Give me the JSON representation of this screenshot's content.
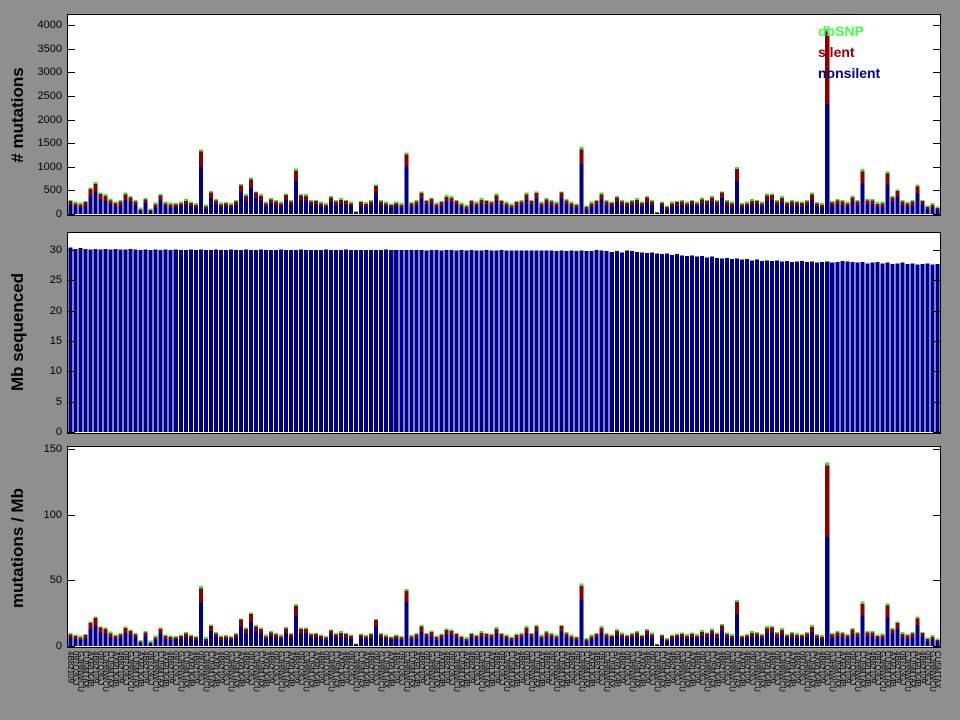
{
  "chart_data": {
    "type": "bar",
    "description": "Per-sample mutation summary: stacked counts, sequenced megabases, and mutation rate",
    "panels": [
      {
        "id": "mutations",
        "ylabel": "# mutations",
        "ylim": [
          0,
          4230
        ],
        "yticks": [
          0,
          500,
          1000,
          1500,
          2000,
          2500,
          3000,
          3500,
          4000
        ],
        "stacked": true,
        "stack_order": [
          "nonsilent",
          "silent",
          "dbSNP"
        ]
      },
      {
        "id": "mb",
        "ylabel": "Mb sequenced",
        "ylim": [
          0,
          33
        ],
        "yticks": [
          0,
          5,
          10,
          15,
          20,
          25,
          30
        ],
        "stacked": false,
        "series": "mb"
      },
      {
        "id": "rate",
        "ylabel": "mutations / Mb",
        "ylim": [
          0,
          152
        ],
        "yticks": [
          0,
          50,
          100,
          150
        ],
        "stacked": true,
        "derived": "(nonsilent+silent+dbSNP)/mb"
      }
    ],
    "legend": [
      {
        "label": "dbSNP",
        "color": "#44FF44"
      },
      {
        "label": "silent",
        "color": "#990000"
      },
      {
        "label": "nonsilent",
        "color": "#00008B"
      }
    ],
    "colors": {
      "nonsilent": "#00008B",
      "silent": "#8B0000",
      "dbSNP": "#33E833",
      "mb": "#00008B",
      "background": "#8F8F8F"
    },
    "grid": false,
    "samples": {
      "count": 174,
      "nonsilent": [
        200,
        165,
        140,
        185,
        390,
        475,
        310,
        285,
        210,
        170,
        195,
        300,
        260,
        195,
        65,
        230,
        55,
        140,
        290,
        165,
        140,
        145,
        165,
        205,
        170,
        140,
        1000,
        110,
        340,
        210,
        140,
        160,
        140,
        190,
        450,
        285,
        545,
        335,
        285,
        160,
        230,
        195,
        160,
        295,
        195,
        700,
        290,
        285,
        190,
        200,
        165,
        135,
        260,
        195,
        220,
        200,
        165,
        25,
        185,
        155,
        190,
        440,
        195,
        160,
        135,
        165,
        135,
        1010,
        160,
        195,
        325,
        200,
        230,
        140,
        185,
        270,
        250,
        200,
        145,
        110,
        200,
        165,
        220,
        200,
        180,
        285,
        200,
        165,
        125,
        185,
        195,
        300,
        200,
        330,
        160,
        230,
        195,
        160,
        335,
        210,
        160,
        135,
        1060,
        100,
        160,
        200,
        305,
        190,
        170,
        255,
        190,
        170,
        195,
        220,
        170,
        255,
        190,
        20,
        170,
        100,
        160,
        185,
        195,
        160,
        200,
        165,
        225,
        200,
        255,
        190,
        335,
        195,
        160,
        700,
        145,
        165,
        205,
        200,
        165,
        285,
        295,
        195,
        250,
        170,
        195,
        175,
        170,
        195,
        300,
        160,
        140,
        2330,
        175,
        215,
        195,
        160,
        260,
        195,
        650,
        210,
        215,
        155,
        160,
        620,
        260,
        360,
        190,
        160,
        195,
        430,
        200,
        100,
        135,
        90
      ],
      "silent": [
        70,
        60,
        60,
        65,
        135,
        165,
        110,
        100,
        80,
        60,
        70,
        110,
        90,
        70,
        35,
        80,
        30,
        60,
        100,
        60,
        60,
        55,
        60,
        75,
        60,
        55,
        320,
        50,
        120,
        75,
        60,
        60,
        55,
        70,
        150,
        100,
        185,
        115,
        100,
        60,
        80,
        70,
        60,
        105,
        70,
        215,
        100,
        100,
        70,
        70,
        60,
        55,
        90,
        70,
        80,
        70,
        60,
        15,
        65,
        60,
        70,
        150,
        70,
        60,
        55,
        60,
        55,
        245,
        60,
        70,
        115,
        70,
        85,
        60,
        65,
        95,
        90,
        70,
        60,
        50,
        70,
        60,
        80,
        70,
        65,
        105,
        70,
        60,
        55,
        65,
        70,
        110,
        70,
        115,
        60,
        80,
        70,
        60,
        115,
        75,
        60,
        55,
        300,
        45,
        60,
        70,
        110,
        70,
        60,
        90,
        70,
        60,
        70,
        80,
        60,
        90,
        70,
        10,
        60,
        45,
        60,
        65,
        70,
        60,
        70,
        60,
        85,
        70,
        90,
        70,
        115,
        70,
        60,
        255,
        55,
        60,
        75,
        70,
        60,
        105,
        105,
        70,
        90,
        60,
        70,
        65,
        60,
        70,
        110,
        60,
        55,
        1530,
        65,
        75,
        70,
        60,
        90,
        70,
        250,
        75,
        75,
        60,
        60,
        235,
        90,
        125,
        70,
        60,
        70,
        150,
        70,
        45,
        55,
        40
      ],
      "dbSNP": [
        30,
        35,
        40,
        30,
        35,
        40,
        30,
        35,
        40,
        30,
        35,
        40,
        30,
        35,
        40,
        30,
        35,
        40,
        30,
        35,
        40,
        30,
        35,
        40,
        30,
        35,
        50,
        40,
        30,
        35,
        40,
        30,
        35,
        40,
        30,
        35,
        40,
        30,
        35,
        40,
        30,
        35,
        40,
        30,
        35,
        45,
        30,
        35,
        40,
        30,
        35,
        40,
        30,
        35,
        40,
        30,
        35,
        20,
        30,
        35,
        40,
        30,
        35,
        40,
        30,
        35,
        40,
        45,
        30,
        35,
        40,
        30,
        35,
        40,
        30,
        35,
        40,
        30,
        35,
        40,
        30,
        35,
        40,
        30,
        35,
        40,
        30,
        35,
        40,
        30,
        35,
        40,
        30,
        35,
        40,
        30,
        35,
        40,
        30,
        35,
        40,
        30,
        60,
        35,
        40,
        30,
        35,
        40,
        30,
        35,
        40,
        30,
        35,
        40,
        30,
        35,
        40,
        10,
        30,
        35,
        40,
        30,
        35,
        40,
        30,
        35,
        40,
        30,
        35,
        40,
        30,
        35,
        40,
        45,
        30,
        35,
        40,
        30,
        35,
        40,
        30,
        35,
        40,
        30,
        35,
        40,
        30,
        35,
        40,
        30,
        35,
        60,
        40,
        30,
        35,
        40,
        30,
        35,
        50,
        35,
        30,
        35,
        40,
        45,
        30,
        35,
        40,
        30,
        35,
        40,
        30,
        35,
        40,
        30
      ],
      "mb": [
        30.4,
        30.2,
        30.3,
        30.2,
        30.1,
        30.2,
        30.1,
        30.2,
        30.1,
        30.2,
        30.1,
        30.1,
        30.2,
        30.1,
        30.0,
        30.1,
        30.0,
        30.1,
        30.0,
        30.1,
        30.0,
        30.1,
        30.0,
        30.0,
        30.1,
        30.0,
        30.1,
        30.0,
        30.0,
        30.1,
        30.0,
        30.0,
        30.1,
        30.0,
        30.0,
        30.1,
        30.0,
        30.0,
        30.1,
        30.0,
        30.0,
        30.0,
        30.1,
        30.0,
        30.0,
        30.0,
        30.1,
        30.0,
        30.0,
        30.0,
        30.0,
        30.1,
        30.0,
        30.0,
        30.0,
        30.1,
        30.0,
        30.0,
        30.0,
        30.0,
        30.0,
        30.0,
        30.0,
        30.1,
        30.0,
        30.0,
        30.0,
        30.0,
        30.0,
        30.0,
        30.0,
        29.9,
        30.0,
        30.0,
        29.9,
        30.0,
        30.0,
        29.9,
        30.0,
        29.9,
        30.0,
        29.9,
        29.9,
        30.0,
        29.9,
        29.9,
        30.0,
        29.9,
        29.9,
        29.9,
        29.9,
        29.9,
        29.9,
        29.9,
        29.9,
        29.9,
        29.9,
        29.8,
        29.9,
        29.8,
        29.9,
        29.8,
        29.9,
        29.8,
        29.8,
        30.0,
        29.9,
        29.8,
        29.7,
        29.8,
        29.6,
        29.9,
        29.8,
        29.7,
        29.6,
        29.5,
        29.6,
        29.4,
        29.3,
        29.4,
        29.2,
        29.3,
        29.1,
        29.0,
        29.1,
        28.9,
        29.0,
        28.8,
        28.9,
        28.7,
        28.6,
        28.7,
        28.5,
        28.6,
        28.4,
        28.5,
        28.3,
        28.4,
        28.2,
        28.3,
        28.2,
        28.3,
        28.1,
        28.2,
        28.0,
        28.1,
        28.2,
        28.0,
        28.1,
        27.9,
        28.0,
        28.1,
        27.9,
        28.0,
        28.2,
        28.1,
        28.0,
        27.9,
        28.0,
        27.8,
        27.9,
        28.0,
        27.8,
        27.9,
        27.7,
        27.8,
        27.9,
        27.7,
        27.8,
        27.6,
        27.7,
        27.8,
        27.6,
        27.7
      ]
    },
    "x_axis": {
      "labels_legible": false,
      "note": "one rotated sample identifier per bar, rendered too small to read",
      "rotation_deg": 90,
      "placeholder_chars": "4U7LW0XH2TGB5QKC9RN1AJ8M3",
      "chars_per_label": 7
    }
  }
}
